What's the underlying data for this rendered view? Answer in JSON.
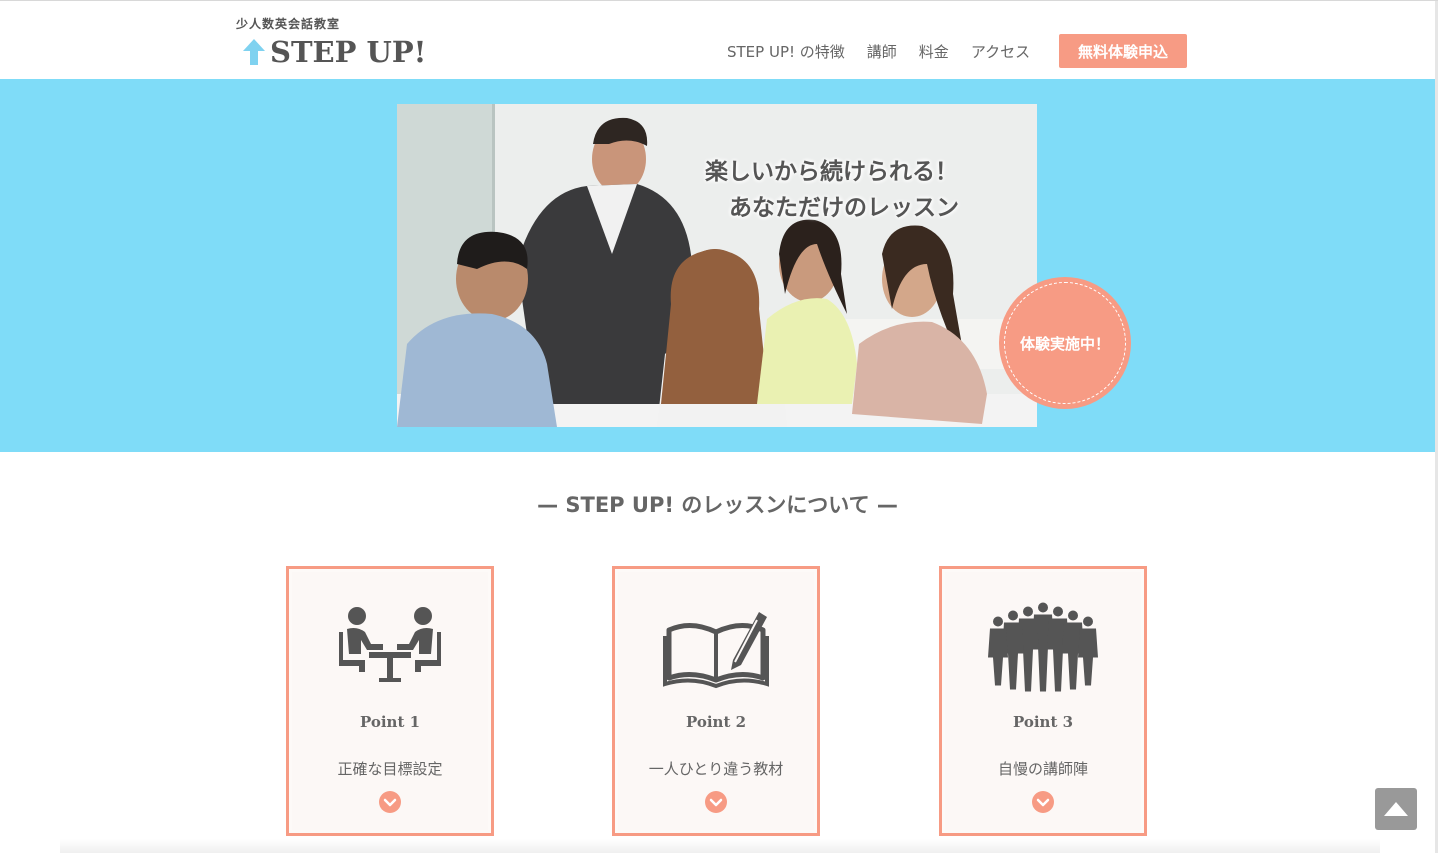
{
  "header": {
    "logo_sub": "少人数英会話教室",
    "logo_main": "STEP UP!",
    "nav": [
      "STEP UP! の特徴",
      "講師",
      "料金",
      "アクセス"
    ],
    "cta": "無料体験申込"
  },
  "hero": {
    "copy_line1": "楽しいから続けられる！",
    "copy_line2": "あなただけのレッスン",
    "badge": "体験実施中！"
  },
  "section": {
    "title": "— STEP UP! のレッスンについて —"
  },
  "cards": [
    {
      "icon": "meeting-table-icon",
      "point": "Point 1",
      "desc": "正確な目標設定"
    },
    {
      "icon": "open-book-pen-icon",
      "point": "Point 2",
      "desc": "一人ひとり違う教材"
    },
    {
      "icon": "team-people-icon",
      "point": "Point 3",
      "desc": "自慢の講師陣"
    }
  ],
  "colors": {
    "accent": "#f79b84",
    "hero_bg": "#7fdcf8",
    "logo_arrow": "#7fd2f0",
    "text": "#555555"
  },
  "scroll_top_icon": "arrow-up-icon"
}
